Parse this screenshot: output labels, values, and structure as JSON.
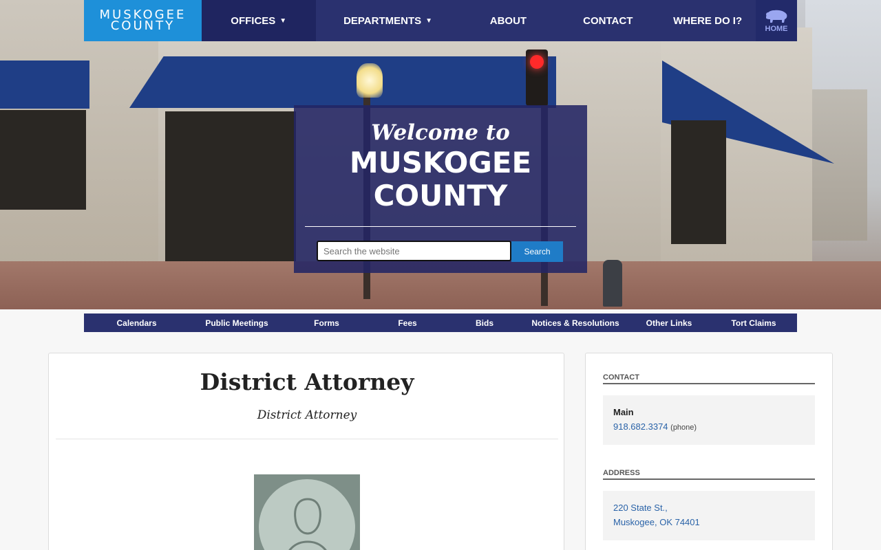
{
  "header": {
    "logo_line1": "MUSKOGEE",
    "logo_line2": "COUNTY",
    "nav": {
      "offices": "OFFICES",
      "departments": "DEPARTMENTS",
      "about": "ABOUT",
      "contact": "CONTACT",
      "where": "WHERE DO I?",
      "home": "HOME"
    }
  },
  "hero": {
    "welcome_script": "Welcome to",
    "title_line1": "MUSKOGEE",
    "title_line2": "COUNTY",
    "search_placeholder": "Search the website",
    "search_button": "Search"
  },
  "subnav": {
    "items": [
      "Calendars",
      "Public Meetings",
      "Forms",
      "Fees",
      "Bids",
      "Notices & Resolutions",
      "Other Links",
      "Tort Claims"
    ]
  },
  "main": {
    "title": "District Attorney",
    "subtitle": "District Attorney"
  },
  "sidebar": {
    "contact_heading": "CONTACT",
    "contact_name": "Main",
    "contact_phone": "918.682.3374",
    "contact_phone_type": "(phone)",
    "address_heading": "ADDRESS",
    "address_line1": "220 State St.,",
    "address_line2": "Muskogee, OK 74401"
  },
  "colors": {
    "nav_bg": "#2a316f",
    "logo_bg": "#1e90d9",
    "link": "#2a63a8",
    "search_button": "#1f7cc7"
  }
}
